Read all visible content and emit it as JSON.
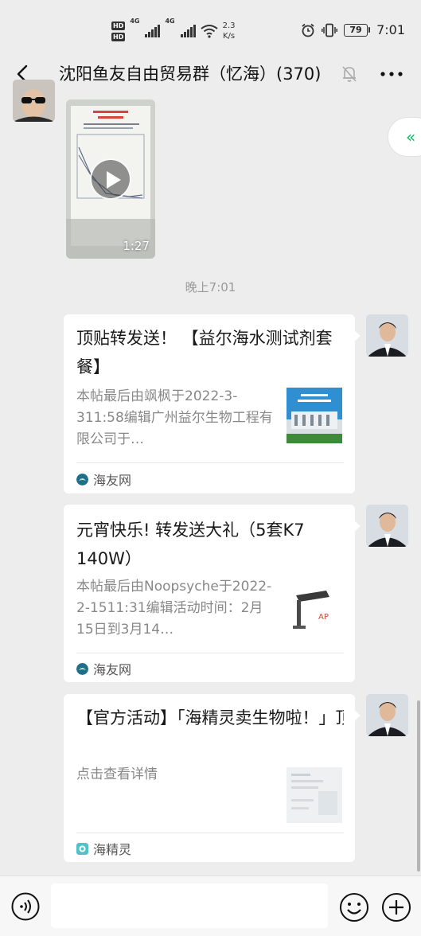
{
  "status_bar": {
    "network_left": "4G",
    "network_right": "4G",
    "speed_value": "2.3",
    "speed_unit": "K/s",
    "battery": "79",
    "time": "7:01"
  },
  "header": {
    "title": "沈阳鱼友自由贸易群（忆海）(370)"
  },
  "messages": {
    "video": {
      "duration": "1:27"
    },
    "timestamp": "晚上7:01",
    "cards": [
      {
        "title": "顶贴转发送！ 【益尔海水测试剂套餐】",
        "desc": "本帖最后由飒枫于2022-3-311:58编辑广州益尔生物工程有限公司于…",
        "source": "海友网"
      },
      {
        "title": "元宵快乐! 转发送大礼（5套K7 140W）",
        "desc": "本帖最后由Noopsyche于2022-2-1511:31编辑活动时间：2月15日到3月14…",
        "source": "海友网"
      },
      {
        "title": "【官方活动】「海精灵卖生物啦！」顶帖盖楼，免费拿小…",
        "desc": "点击查看详情",
        "source": "海精灵"
      }
    ]
  },
  "colors": {
    "background": "#ededed",
    "accent_green": "#07c160",
    "source_icon_haiyou": "#1f6f8b",
    "source_icon_haijingling": "#4fc3c8"
  },
  "icons": {
    "back": "back-arrow-icon",
    "mute": "bell-off-icon",
    "more": "more-dots-icon",
    "scroll": "double-chevron-up-icon",
    "voice": "voice-icon",
    "emoji": "emoji-icon",
    "plus": "plus-circle-icon"
  }
}
